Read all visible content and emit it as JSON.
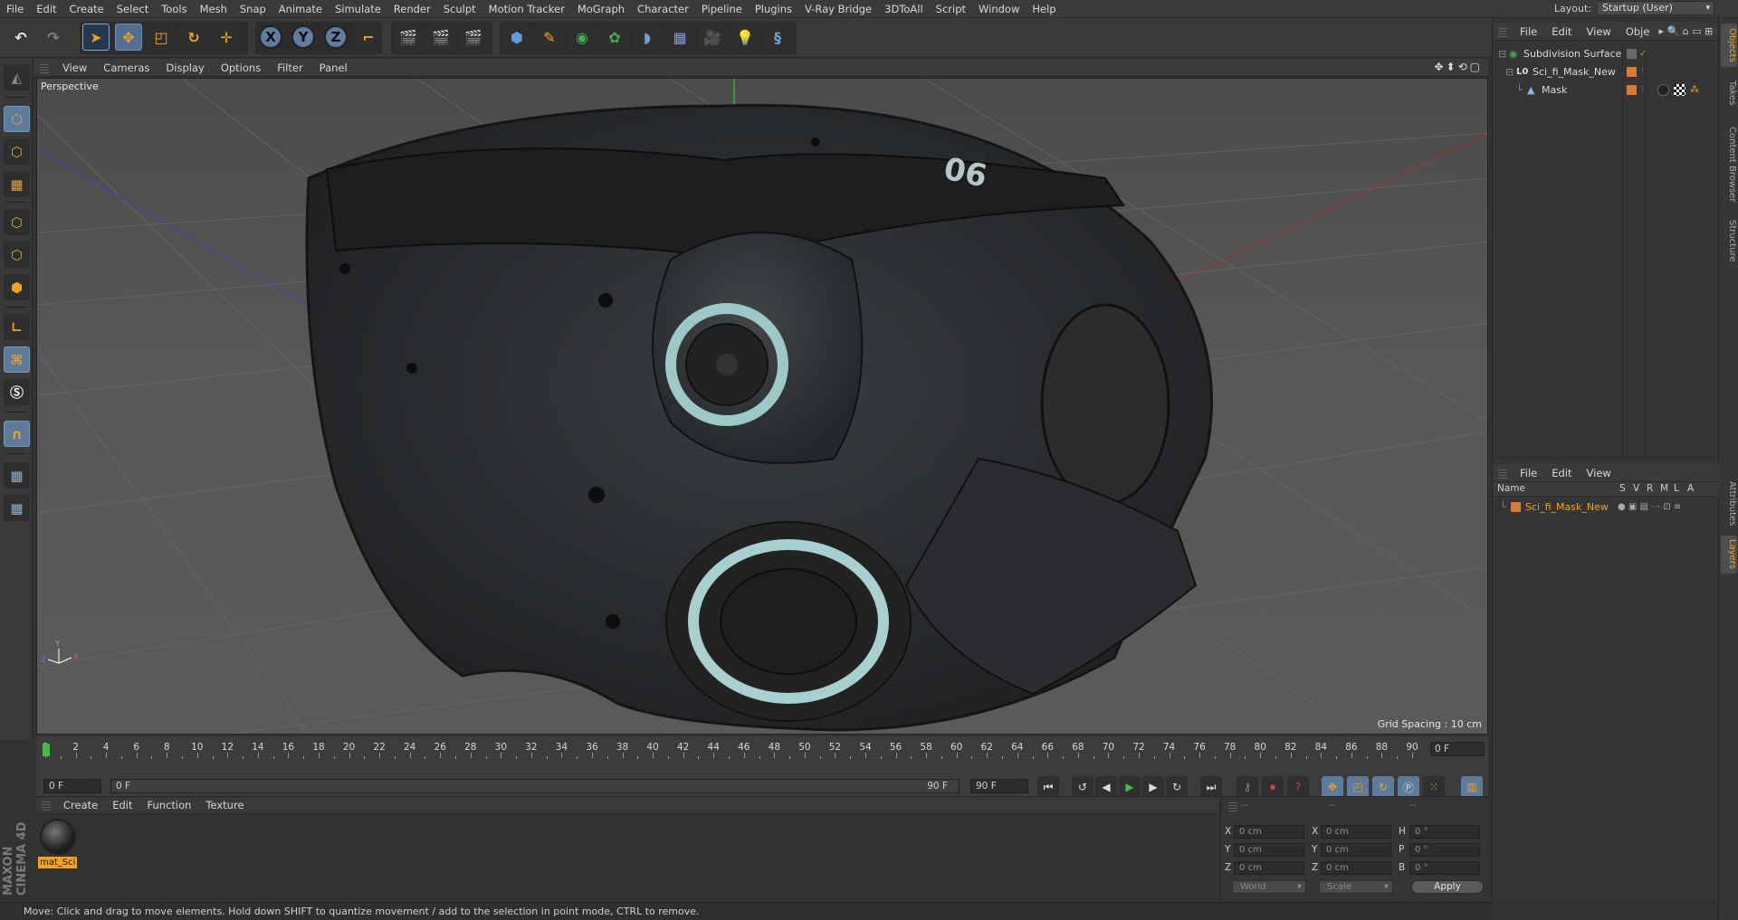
{
  "menubar": {
    "items": [
      "File",
      "Edit",
      "Create",
      "Select",
      "Tools",
      "Mesh",
      "Snap",
      "Animate",
      "Simulate",
      "Render",
      "Sculpt",
      "Motion Tracker",
      "MoGraph",
      "Character",
      "Pipeline",
      "Plugins",
      "V-Ray Bridge",
      "3DToAll",
      "Script",
      "Window",
      "Help"
    ],
    "layout_label": "Layout:",
    "layout_value": "Startup (User)"
  },
  "toolbar": {
    "axis_x": "X",
    "axis_y": "Y",
    "axis_z": "Z"
  },
  "viewport": {
    "menu": [
      "View",
      "Cameras",
      "Display",
      "Options",
      "Filter",
      "Panel"
    ],
    "label": "Perspective",
    "grid_spacing": "Grid Spacing : 10 cm"
  },
  "object_manager": {
    "menu": [
      "File",
      "Edit",
      "View",
      "Obje"
    ],
    "objects": [
      {
        "name": "Subdivision Surface"
      },
      {
        "name": "Sci_fi_Mask_New"
      },
      {
        "name": "Mask"
      }
    ]
  },
  "right_tabs": [
    "Objects",
    "Takes",
    "Content Browser",
    "Structure"
  ],
  "right_tabs_lower": [
    "Attributes",
    "Layers"
  ],
  "layer_manager": {
    "menu": [
      "File",
      "Edit",
      "View"
    ],
    "columns": [
      "Name",
      "S",
      "V",
      "R",
      "M",
      "L",
      "A"
    ],
    "layers": [
      {
        "name": "Sci_fi_Mask_New",
        "color": "#e07a2a"
      }
    ]
  },
  "timeline": {
    "labels": [
      "0",
      "2",
      "4",
      "6",
      "8",
      "10",
      "12",
      "14",
      "16",
      "18",
      "20",
      "22",
      "24",
      "26",
      "28",
      "30",
      "32",
      "34",
      "36",
      "38",
      "40",
      "42",
      "44",
      "46",
      "48",
      "50",
      "52",
      "54",
      "56",
      "58",
      "60",
      "62",
      "64",
      "66",
      "68",
      "70",
      "72",
      "74",
      "76",
      "78",
      "80",
      "82",
      "84",
      "86",
      "88",
      "90"
    ],
    "current_frame_right": "0 F"
  },
  "transport": {
    "start_field": "0 F",
    "range_start": "0 F",
    "range_end": "90 F",
    "end_field": "90 F"
  },
  "material_manager": {
    "menu": [
      "Create",
      "Edit",
      "Function",
      "Texture"
    ],
    "materials": [
      {
        "name": "mat_Sci"
      }
    ]
  },
  "coordinates": {
    "header_dashes": [
      "--",
      "--",
      "--"
    ],
    "rows": [
      {
        "a": "X",
        "a_val": "0 cm",
        "b": "X",
        "b_val": "0 cm",
        "c": "H",
        "c_val": "0 °"
      },
      {
        "a": "Y",
        "a_val": "0 cm",
        "b": "Y",
        "b_val": "0 cm",
        "c": "P",
        "c_val": "0 °"
      },
      {
        "a": "Z",
        "a_val": "0 cm",
        "b": "Z",
        "b_val": "0 cm",
        "c": "B",
        "c_val": "0 °"
      }
    ],
    "mode": "World",
    "scale": "Scale",
    "apply": "Apply"
  },
  "status": "Move: Click and drag to move elements. Hold down SHIFT to quantize movement / add to the selection in point mode, CTRL to remove.",
  "brand": "MAXON CINEMA 4D",
  "colors": {
    "accent": "#f3a21b",
    "selected_blue": "#5d7b9c",
    "playhead": "#3ec13e"
  }
}
